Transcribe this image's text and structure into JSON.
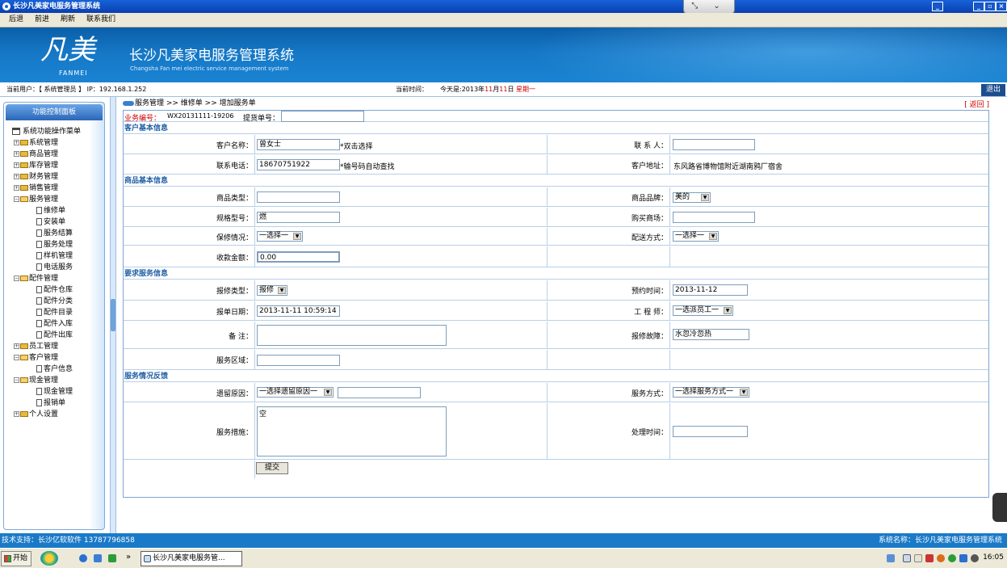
{
  "window": {
    "title": "长沙凡美家电服务管理系统",
    "fullscreen_tab": "⤡ ⌄"
  },
  "menubar": {
    "back": "后退",
    "forward": "前进",
    "refresh": "刷新",
    "contact": "联系我们"
  },
  "banner": {
    "logo_main": "凡美",
    "logo_sub": "FANMEI",
    "title": "长沙凡美家电服务管理系统",
    "subtitle": "Changsha Fan mei electric service management system"
  },
  "userbar": {
    "current_user": "当前用户：【 系统管理员 】 IP：192.168.1.252",
    "time_label": "当前时间：",
    "time_prefix": "今天是:2013年",
    "month": "11",
    "month_suffix": "月",
    "day": "11",
    "day_suffix": "日",
    "weekday": "星期一",
    "exit": "退出"
  },
  "sidebar": {
    "title": "功能控制面板",
    "root": "系统功能操作菜单",
    "groups": [
      {
        "label": "系统管理",
        "open": false,
        "items": []
      },
      {
        "label": "商品管理",
        "open": false,
        "items": []
      },
      {
        "label": "库存管理",
        "open": false,
        "items": []
      },
      {
        "label": "财务管理",
        "open": false,
        "items": []
      },
      {
        "label": "销售管理",
        "open": false,
        "items": []
      },
      {
        "label": "服务管理",
        "open": true,
        "items": [
          "维修单",
          "安装单",
          "服务结算",
          "服务处理",
          "样机管理",
          "电话服务"
        ]
      },
      {
        "label": "配件管理",
        "open": true,
        "items": [
          "配件仓库",
          "配件分类",
          "配件目录",
          "配件入库",
          "配件出库"
        ]
      },
      {
        "label": "员工管理",
        "open": false,
        "items": []
      },
      {
        "label": "客户管理",
        "open": true,
        "items": [
          "客户信息"
        ]
      },
      {
        "label": "现金管理",
        "open": true,
        "items": [
          "现金管理",
          "报销单"
        ]
      },
      {
        "label": "个人设置",
        "open": false,
        "items": []
      }
    ]
  },
  "breadcrumb": "服务管理 >> 维修单 >> 增加服务单",
  "back_link": "[ 返回 ]",
  "form": {
    "biz_no_label": "业务编号：",
    "biz_no": "WX20131111-19206",
    "pickup_no_label": "提货单号：",
    "pickup_no": "",
    "sec_customer": "客户基本信息",
    "customer_name_label": "客户名称：",
    "customer_name": "曾女士",
    "customer_name_hint": "*双击选择",
    "contact_label": "联 系 人：",
    "contact": "",
    "phone_label": "联系电话：",
    "phone": "18670751922",
    "phone_hint": "*输号码自动查找",
    "address_label": "客户地址：",
    "address": "东风路省博物馆附近湖南鸦厂宿舍",
    "sec_product": "商品基本信息",
    "product_type_label": "商品类型：",
    "product_type": "",
    "brand_label": "商品品牌：",
    "brand": "美的",
    "model_label": "规格型号：",
    "model": "燃",
    "store_label": "购买商场：",
    "store": "",
    "warranty_label": "保修情况：",
    "warranty": "一选择一",
    "delivery_label": "配送方式：",
    "delivery": "一选择一",
    "fee_label": "收款金额：",
    "fee": "0.00",
    "sec_request": "要求服务信息",
    "repair_type_label": "报修类型：",
    "repair_type": "报修",
    "appt_label": "预约时间：",
    "appt": "2013-11-12",
    "report_date_label": "报单日期：",
    "report_date": "2013-11-11 10:59:14",
    "engineer_label": "工 程 师：",
    "engineer": "一选派员工一",
    "remark_label": "备 注：",
    "remark": "",
    "fault_label": "报修故障：",
    "fault": "水忽冷忽热",
    "area_label": "服务区域：",
    "area": "",
    "sec_feedback": "服务情况反馈",
    "left_reason_label": "遗留原因：",
    "left_reason": "一选择遗留原因一",
    "left_reason_extra": "",
    "service_mode_label": "服务方式：",
    "service_mode": "一选择服务方式一",
    "measure_label": "服务措施：",
    "measure": "空",
    "handle_time_label": "处理时间：",
    "handle_time": "",
    "submit": "提交"
  },
  "statusbar": {
    "support": "技术支持：长沙亿软软件 13787796858",
    "system": "系统名称：长沙凡美家电服务管理系统"
  },
  "taskbar": {
    "start": "开始",
    "chevron": "»",
    "task": "长沙凡美家电服务管...",
    "clock": "16:05"
  }
}
